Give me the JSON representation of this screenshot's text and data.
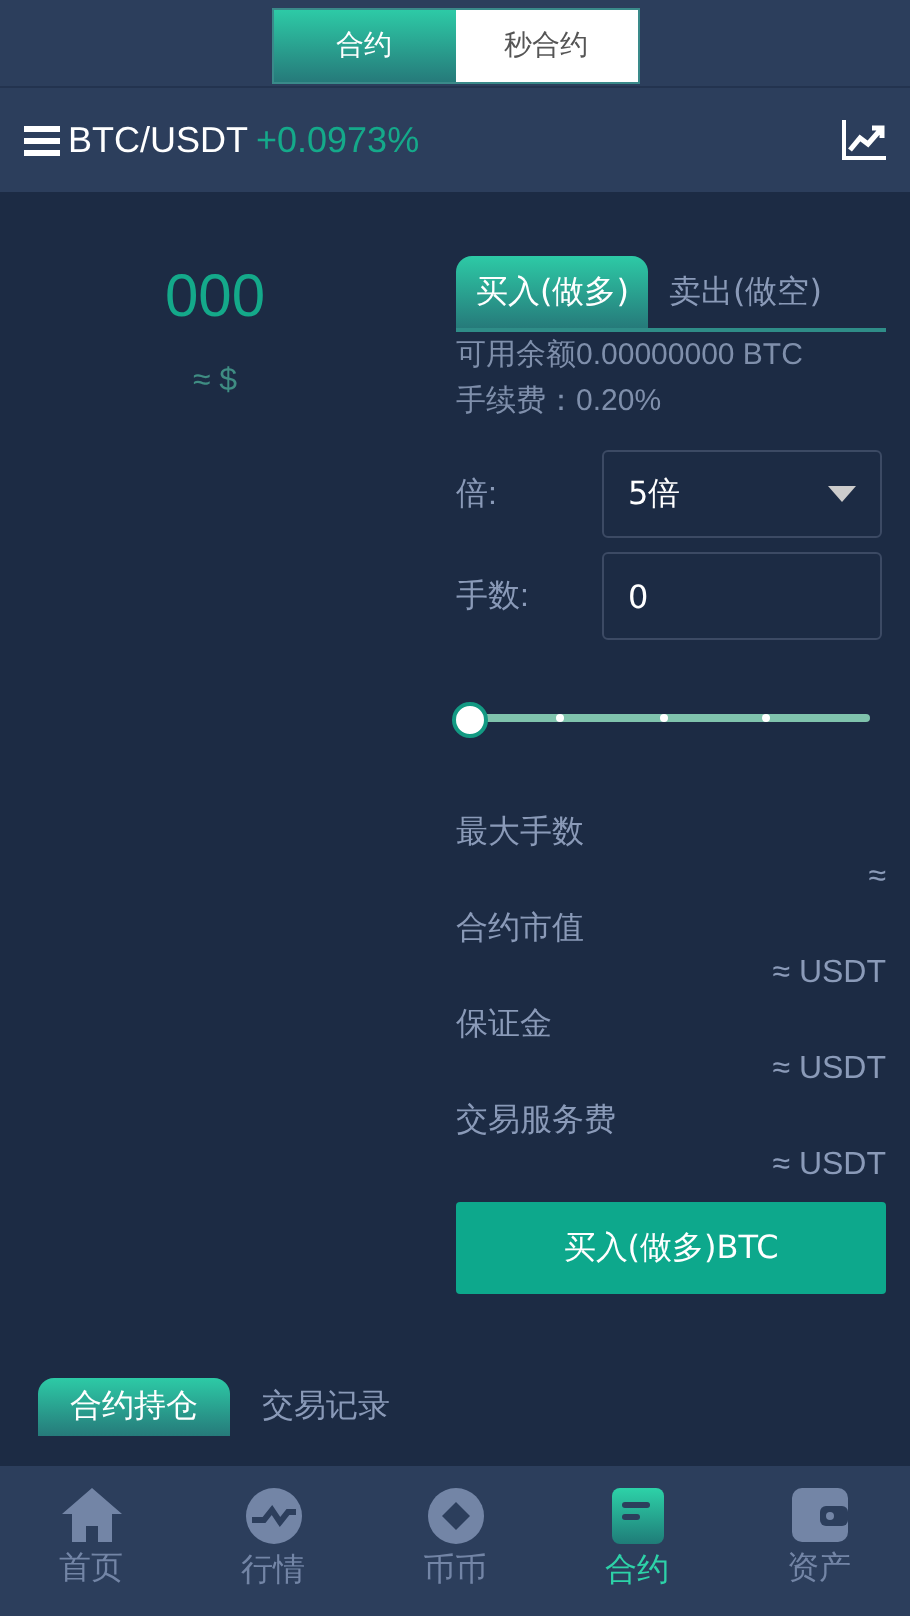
{
  "mode_switch": [
    {
      "label": "合约",
      "selected": true
    },
    {
      "label": "秒合约",
      "selected": false
    }
  ],
  "header": {
    "pair": "BTC/USDT",
    "change": "+0.0973%"
  },
  "price": {
    "value": "000",
    "approx": "≈ $"
  },
  "order_tabs": [
    {
      "label": "买入(做多)",
      "selected": true
    },
    {
      "label": "卖出(做空)",
      "selected": false
    }
  ],
  "balance": "可用余额0.00000000 BTC",
  "fee": "手续费：0.20%",
  "leverage": {
    "label": "倍:",
    "value": "5倍"
  },
  "lots": {
    "label": "手数:",
    "value": "0"
  },
  "slider": {
    "level": 0
  },
  "stats": [
    {
      "label": "最大手数",
      "value": "≈"
    },
    {
      "label": "合约市值",
      "value": "≈ USDT"
    },
    {
      "label": "保证金",
      "value": "≈ USDT"
    },
    {
      "label": "交易服务费",
      "value": "≈ USDT"
    }
  ],
  "submit": "买入(做多)BTC",
  "position_tabs": [
    {
      "label": "合约持仓",
      "selected": true
    },
    {
      "label": "交易记录",
      "selected": false
    }
  ],
  "nav": [
    {
      "label": "首页",
      "selected": false
    },
    {
      "label": "行情",
      "selected": false
    },
    {
      "label": "币币",
      "selected": false
    },
    {
      "label": "合约",
      "selected": true
    },
    {
      "label": "资产",
      "selected": false
    }
  ]
}
